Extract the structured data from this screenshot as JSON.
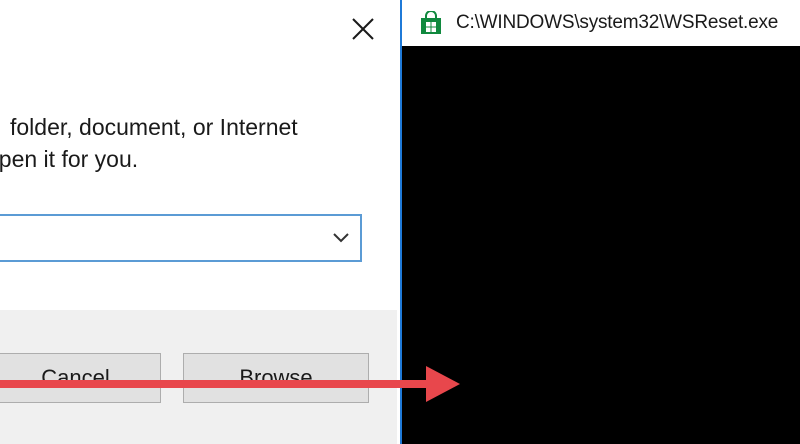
{
  "run_dialog": {
    "description_line1": "folder, document, or Internet",
    "description_line2": "open it for you.",
    "open_value": "",
    "cancel_label": "Cancel",
    "browse_label": "Browse",
    "close_icon": "close-icon",
    "dropdown_icon": "chevron-down-icon"
  },
  "console": {
    "title": "C:\\WINDOWS\\system32\\WSReset.exe",
    "icon": "store-icon"
  },
  "annotation": {
    "type": "arrow",
    "color": "#e8474c"
  },
  "colors": {
    "combo_border": "#5b9bd5",
    "window_border": "#1f7ad8",
    "console_bg": "#000000",
    "footer_bg": "#f0f0f0",
    "store_icon": "#10893e"
  }
}
